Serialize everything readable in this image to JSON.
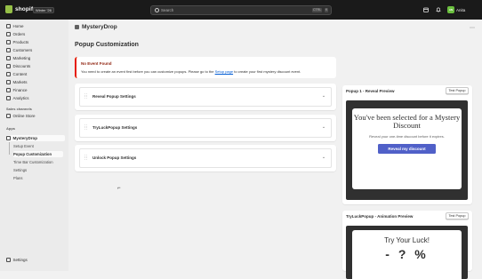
{
  "topbar": {
    "brand": "shopify",
    "edition": "Winter '26",
    "search_placeholder": "Search",
    "shortcut_key1": "CTRL",
    "shortcut_key2": "K",
    "store_initials": "AN",
    "store_name": "Anita"
  },
  "sidebar": {
    "items": [
      {
        "label": "Home",
        "icon": "home-icon"
      },
      {
        "label": "Orders",
        "icon": "orders-icon"
      },
      {
        "label": "Products",
        "icon": "tag-icon"
      },
      {
        "label": "Customers",
        "icon": "person-icon"
      },
      {
        "label": "Marketing",
        "icon": "target-icon"
      },
      {
        "label": "Discounts",
        "icon": "discount-icon"
      },
      {
        "label": "Content",
        "icon": "content-icon"
      },
      {
        "label": "Markets",
        "icon": "globe-icon"
      },
      {
        "label": "Finance",
        "icon": "finance-icon"
      },
      {
        "label": "Analytics",
        "icon": "chart-icon"
      }
    ],
    "sales_channels_label": "Sales channels",
    "online_store": "Online Store",
    "apps_label": "Apps",
    "app_name": "MysteryDrop",
    "app_subitems": [
      "Setup Event",
      "Popup Customization",
      "Time Bar Customization",
      "Settings",
      "Plans"
    ],
    "settings": "Settings"
  },
  "header": {
    "app_title": "MysteryDrop",
    "page_title": "Popup Customization"
  },
  "banner": {
    "title": "No Event Found",
    "text_before": "You need to create an event first before you can customize popups. Please go to the ",
    "link": "Setup page",
    "text_after": " to create your first mystery discount event."
  },
  "accordions": [
    "Reveal Popup Settings",
    "TryLuckPopup Settings",
    "Unlock Popup Settings"
  ],
  "previews": [
    {
      "title": "Popup 1 - Reveal Preview",
      "button": "Test Popup",
      "heading": "You've been selected for a Mystery Discount",
      "body": "Reveal your one-time discount before it expires.",
      "cta": "Reveal my discount"
    },
    {
      "title": "TryLuckPopup - Animation Preview",
      "button": "Test Popup",
      "heading": "Try Your Luck!",
      "partial": "- ? %"
    }
  ],
  "colors": {
    "topbar": "#1a1a1a",
    "accent_button": "#5060c8",
    "critical": "#e51c00",
    "link": "#005bd3"
  }
}
